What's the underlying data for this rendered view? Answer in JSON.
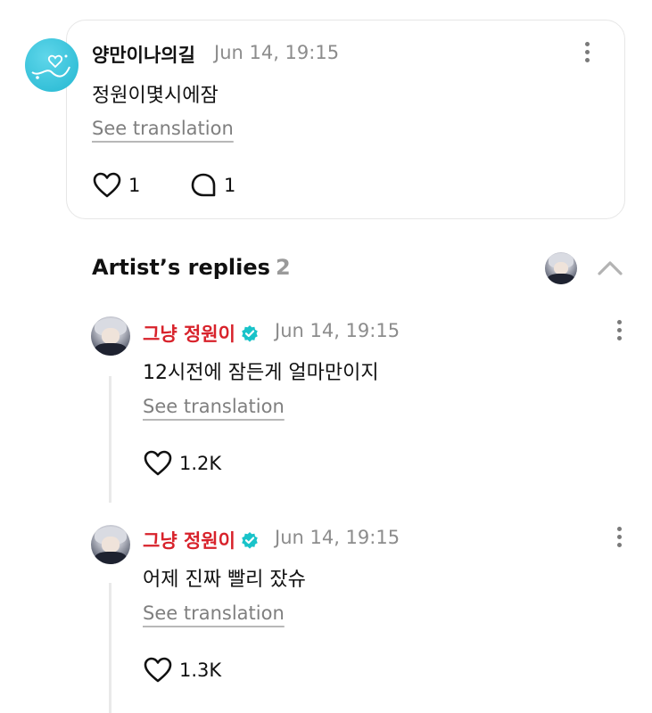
{
  "comment": {
    "author": "양만이나의길",
    "time": "Jun 14, 19:15",
    "text": "정원이몇시에잠",
    "see_translation": "See translation",
    "likes": "1",
    "replies": "1"
  },
  "artist_replies": {
    "title": "Artist’s replies",
    "count": "2",
    "items": [
      {
        "author": "그냥 정원이",
        "time": "Jun 14, 19:15",
        "text": "12시전에 잠든게 얼마만이지",
        "see_translation": "See translation",
        "likes": "1.2K"
      },
      {
        "author": "그냥 정원이",
        "time": "Jun 14, 19:15",
        "text": "어제 진짜 빨리 잤슈",
        "see_translation": "See translation",
        "likes": "1.3K"
      }
    ]
  },
  "colors": {
    "artist_name": "#d8222b",
    "verified": "#19c3c9",
    "muted": "#8c8c8c"
  }
}
